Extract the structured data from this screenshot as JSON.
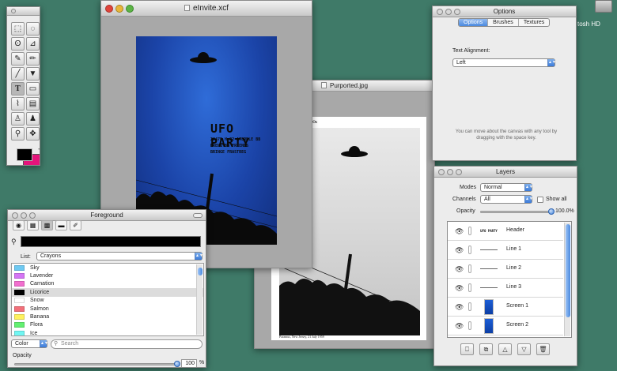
{
  "desktop": {
    "disk_label": "tosh HD"
  },
  "toolbox": {
    "tools": [
      {
        "name": "rect-select-icon",
        "glyph": "⬚"
      },
      {
        "name": "ellipse-select-icon",
        "glyph": "◌"
      },
      {
        "name": "lasso-icon",
        "glyph": "ʘ"
      },
      {
        "name": "polygon-lasso-icon",
        "glyph": "⊿"
      },
      {
        "name": "brush-icon",
        "glyph": "✎"
      },
      {
        "name": "pencil-icon",
        "glyph": "✏"
      },
      {
        "name": "line-icon",
        "glyph": "╱"
      },
      {
        "name": "paint-bucket-icon",
        "glyph": "▼"
      },
      {
        "name": "text-tool-icon",
        "glyph": "T"
      },
      {
        "name": "eraser-icon",
        "glyph": "▭"
      },
      {
        "name": "eyedropper-icon",
        "glyph": "⌇"
      },
      {
        "name": "gradient-icon",
        "glyph": "▤"
      },
      {
        "name": "clone-stamp-icon",
        "glyph": "♙"
      },
      {
        "name": "stamp-icon",
        "glyph": "♟"
      },
      {
        "name": "zoom-icon",
        "glyph": "⚲"
      },
      {
        "name": "move-icon",
        "glyph": "✥"
      }
    ],
    "colors": {
      "foreground": "#000000",
      "background": "#e4147b"
    }
  },
  "invite_window": {
    "title": "eInvite.xcf",
    "poster": {
      "heading": "UFO PARTY",
      "lines": [
        "2047E H 22 ATERBLE BB",
        "BRENG BB FRIENDS",
        "BRINGE FRASTREG"
      ],
      "color": "#1b44a8"
    }
  },
  "photo_window": {
    "title": "Purported.jpg",
    "caption": "Photo of alleged UFOs",
    "footer": "Paramus, New Jersey, 21 July 1959"
  },
  "options": {
    "title": "Options",
    "tabs": [
      "Options",
      "Brushes",
      "Textures"
    ],
    "active_tab": "Options",
    "text_alignment_label": "Text Alignment:",
    "text_alignment_value": "Left",
    "hint": "You can move about the canvas with any tool by dragging with the space key."
  },
  "layers": {
    "title": "Layers",
    "modes_label": "Modes",
    "modes_value": "Normal",
    "channels_label": "Channels",
    "channels_value": "All",
    "show_all_label": "Show all",
    "opacity_label": "Opacity",
    "opacity_value": "100.0%",
    "opacity_fraction": 1.0,
    "items": [
      {
        "name": "Header",
        "thumb": "UFO PARTY",
        "kind": "text"
      },
      {
        "name": "Line 1",
        "thumb": "",
        "kind": "line"
      },
      {
        "name": "Line 2",
        "thumb": "",
        "kind": "line"
      },
      {
        "name": "Line 3",
        "thumb": "",
        "kind": "line"
      },
      {
        "name": "Screen 1",
        "thumb": "",
        "kind": "screen"
      },
      {
        "name": "Screen 2",
        "thumb": "",
        "kind": "screen"
      }
    ],
    "buttons": [
      {
        "name": "new-layer-icon",
        "glyph": "⎕"
      },
      {
        "name": "duplicate-layer-icon",
        "glyph": "⧉"
      },
      {
        "name": "raise-layer-icon",
        "glyph": "△"
      },
      {
        "name": "lower-layer-icon",
        "glyph": "▽"
      },
      {
        "name": "trash-icon",
        "glyph": "🗑"
      }
    ]
  },
  "foreground": {
    "title": "Foreground",
    "list_label": "List:",
    "list_value": "Crayons",
    "colors": [
      {
        "name": "Sky",
        "hex": "#6ec9f2"
      },
      {
        "name": "Lavender",
        "hex": "#d575f5"
      },
      {
        "name": "Carnation",
        "hex": "#f26fcf"
      },
      {
        "name": "Licorice",
        "hex": "#000000"
      },
      {
        "name": "Snow",
        "hex": "#ffffff"
      },
      {
        "name": "Salmon",
        "hex": "#f2707a"
      },
      {
        "name": "Banana",
        "hex": "#fff25e"
      },
      {
        "name": "Flora",
        "hex": "#63f071"
      },
      {
        "name": "Ice",
        "hex": "#70f6f2"
      }
    ],
    "selected": "Licorice",
    "sort_value": "Color",
    "search_placeholder": "Search",
    "opacity_label": "Opacity",
    "opacity_value": "100",
    "opacity_unit": "%",
    "opacity_fraction": 1.0
  }
}
